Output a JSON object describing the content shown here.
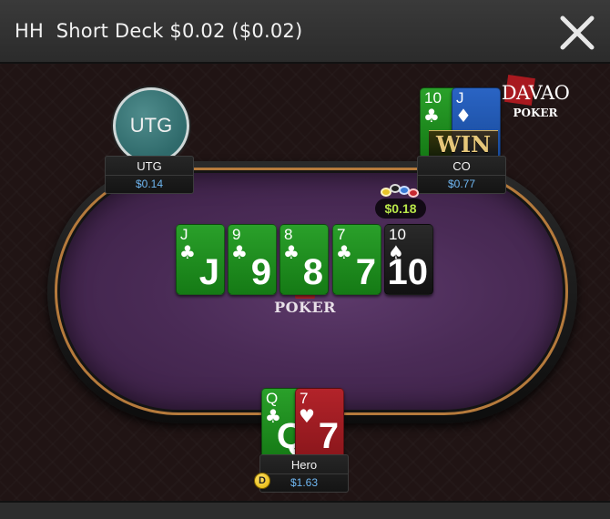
{
  "window": {
    "title": "HH  Short Deck $0.02 ($0.02)",
    "close_icon": "close-icon"
  },
  "table": {
    "logo_text": "POKER",
    "pot": "$0.18",
    "board": [
      {
        "rank": "J",
        "suit": "♣",
        "color": "green"
      },
      {
        "rank": "9",
        "suit": "♣",
        "color": "green"
      },
      {
        "rank": "8",
        "suit": "♣",
        "color": "green"
      },
      {
        "rank": "7",
        "suit": "♣",
        "color": "green"
      },
      {
        "rank": "10",
        "suit": "♠",
        "color": "black"
      }
    ]
  },
  "brand": {
    "name": "DAVAO",
    "sub": "POKER"
  },
  "players": {
    "utg": {
      "avatar_text": "UTG",
      "name": "UTG",
      "stack": "$0.14"
    },
    "co": {
      "name": "CO",
      "stack": "$0.77",
      "win_label": "WIN",
      "cards": [
        {
          "rank": "10",
          "suit": "♣",
          "color": "green"
        },
        {
          "rank": "J",
          "suit": "♦",
          "color": "blue"
        }
      ]
    },
    "hero": {
      "name": "Hero",
      "stack": "$1.63",
      "dealer_button": "D",
      "cards": [
        {
          "rank": "Q",
          "suit": "♣",
          "color": "green"
        },
        {
          "rank": "7",
          "suit": "♥",
          "color": "red"
        }
      ]
    }
  },
  "colors": {
    "felt": "#4a2b56",
    "rim": "#b57a3c",
    "stack_text": "#6fb7f2",
    "pot_text": "#b8e64a"
  }
}
